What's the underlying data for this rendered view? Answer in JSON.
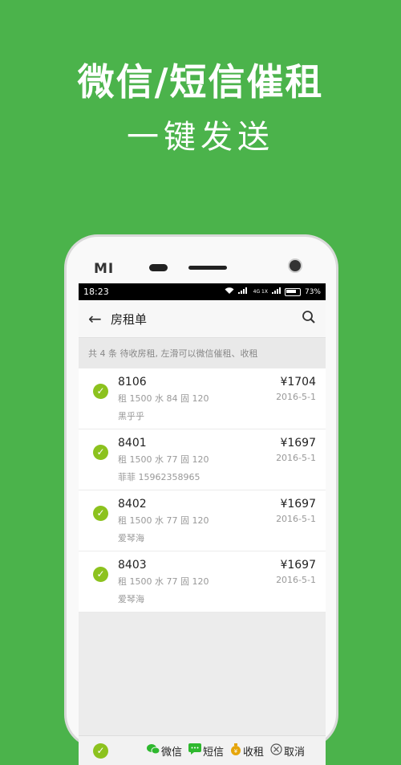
{
  "promo": {
    "headline": "微信/短信催租",
    "subline": "一键发送"
  },
  "device": {
    "brand": "MI"
  },
  "status": {
    "time": "18:23",
    "signal_labels": "4G 1X",
    "battery": "73%"
  },
  "appbar": {
    "title": "房租单",
    "back_icon": "arrow-left-icon",
    "search_icon": "search-icon"
  },
  "hint": "共 4 条 待收房租, 左滑可以微信催租、收租",
  "items": [
    {
      "room": "8106",
      "detail": "租 1500 水 84 固 120",
      "tenant": "黑乎乎",
      "price": "¥1704",
      "date": "2016-5-1"
    },
    {
      "room": "8401",
      "detail": "租 1500 水 77 固 120",
      "tenant": "菲菲 15962358965",
      "price": "¥1697",
      "date": "2016-5-1"
    },
    {
      "room": "8402",
      "detail": "租 1500 水 77 固 120",
      "tenant": "爱琴海",
      "price": "¥1697",
      "date": "2016-5-1"
    },
    {
      "room": "8403",
      "detail": "租 1500 水 77 固 120",
      "tenant": "爱琴海",
      "price": "¥1697",
      "date": "2016-5-1"
    }
  ],
  "bottom": {
    "wechat": "微信",
    "sms": "短信",
    "collect": "收租",
    "cancel": "取消"
  }
}
